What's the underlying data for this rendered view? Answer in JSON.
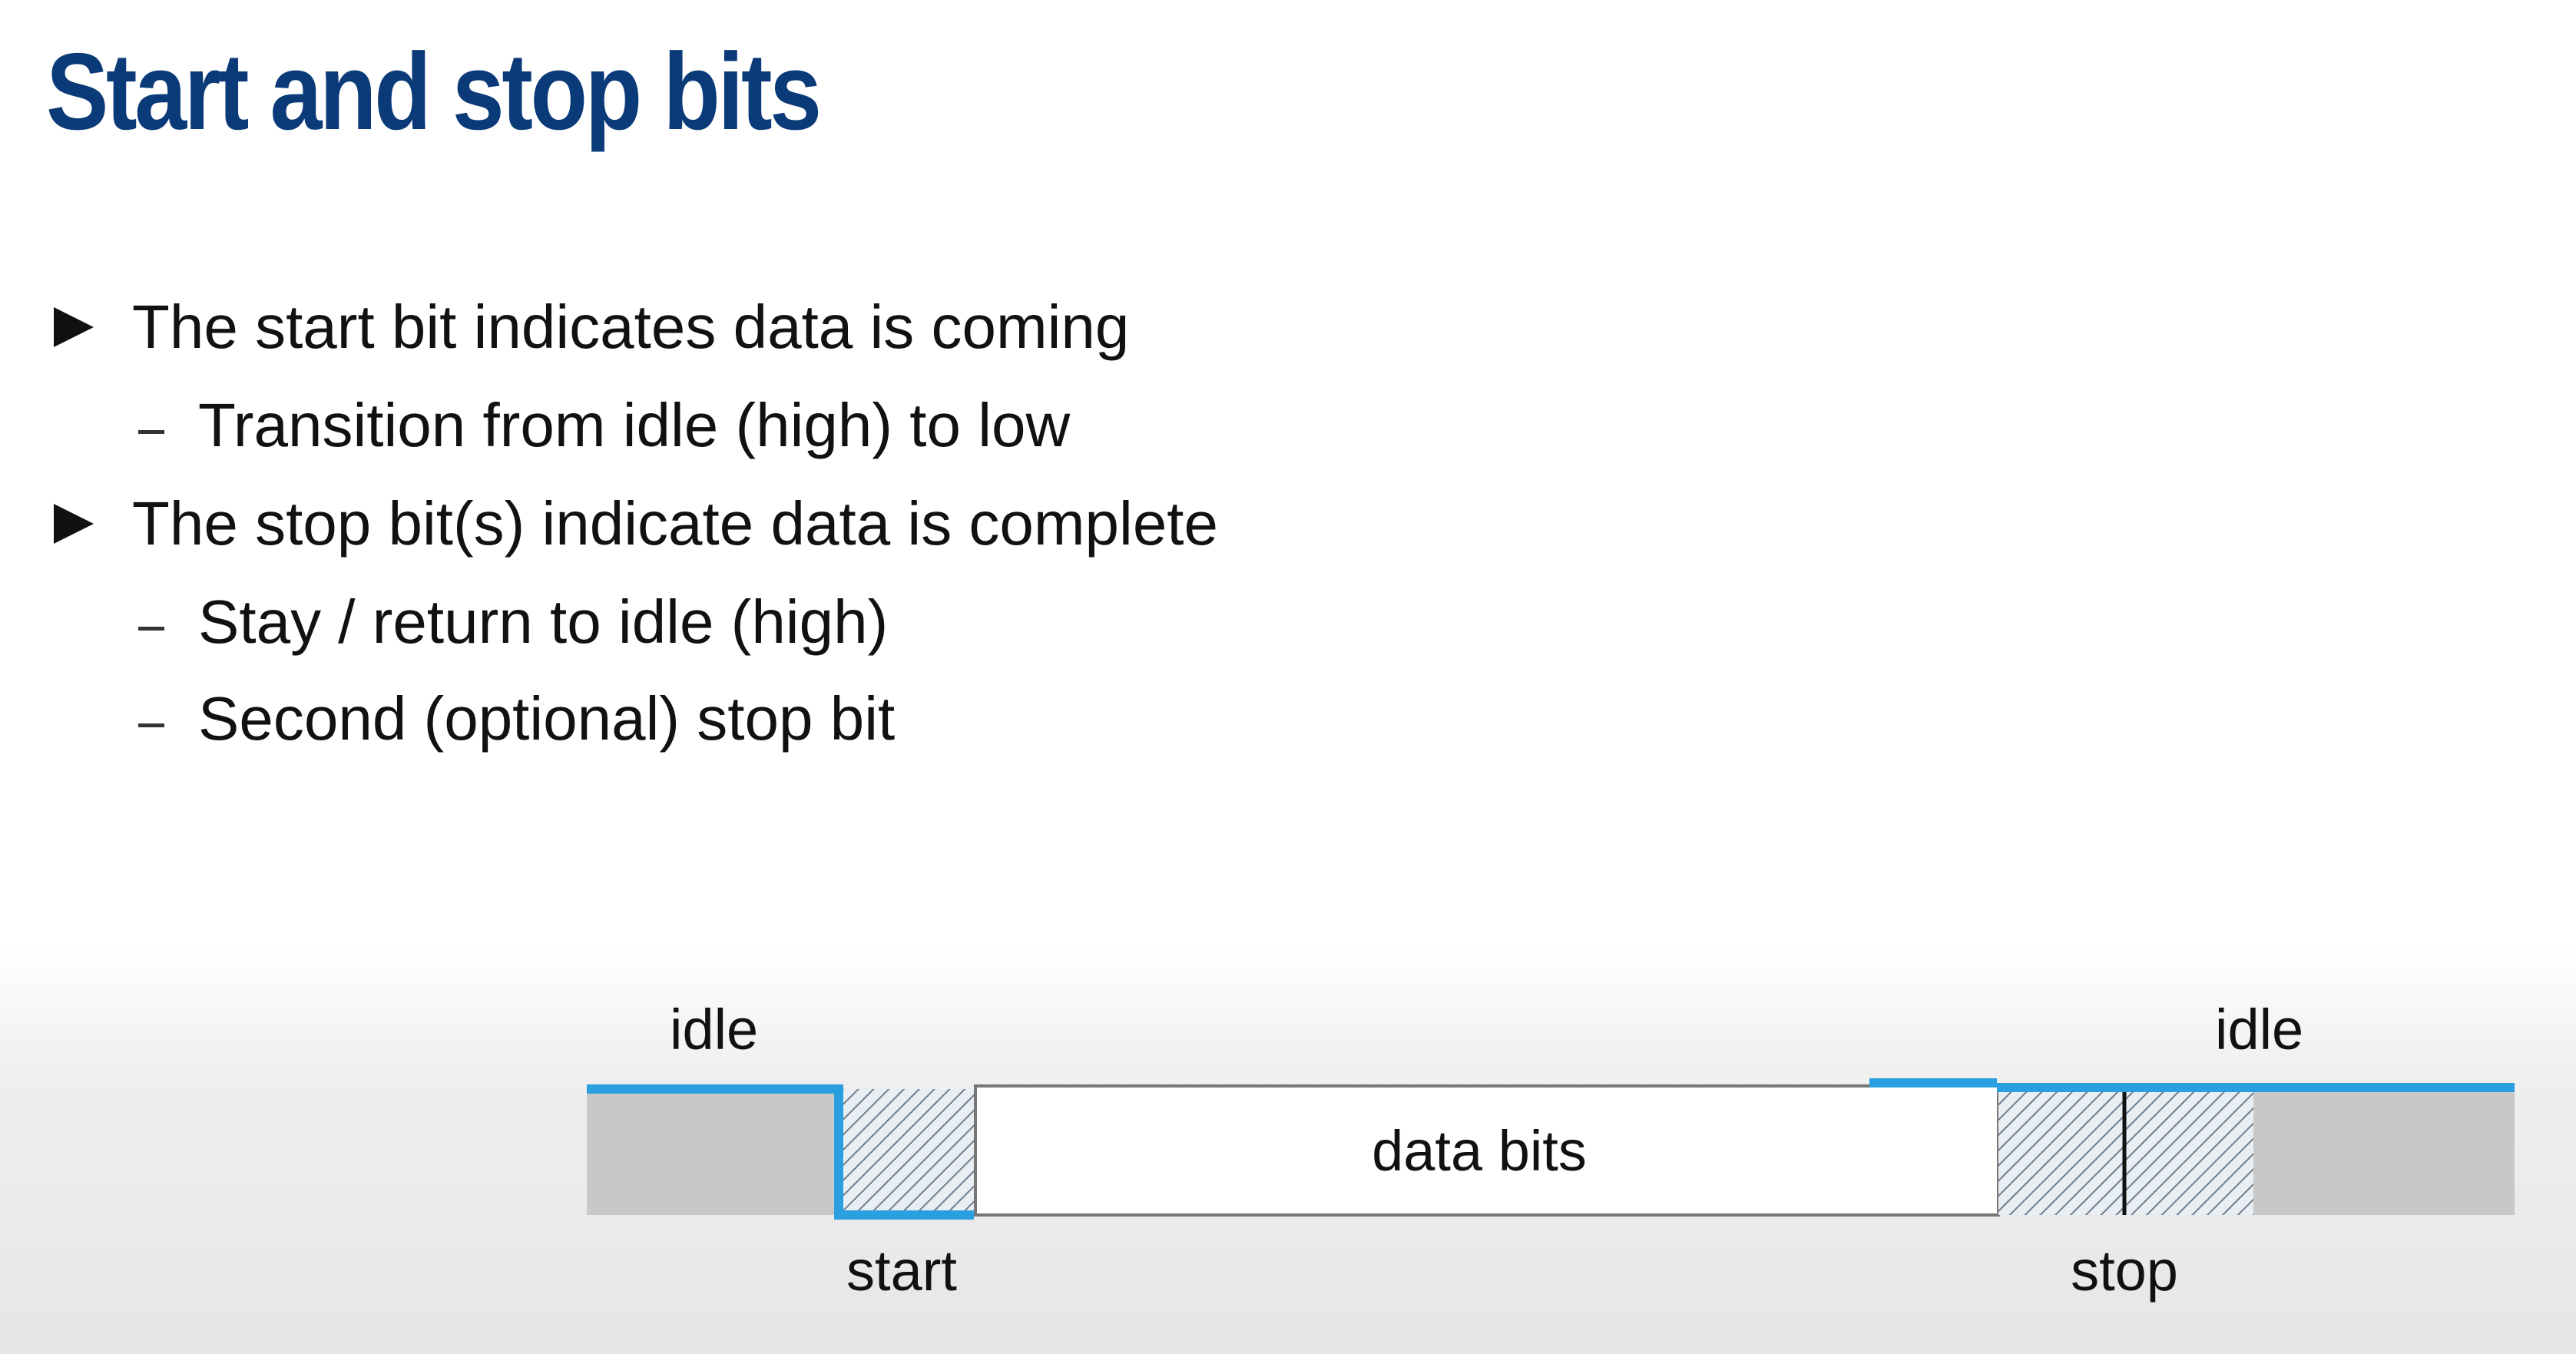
{
  "slide": {
    "title": "Start and stop bits"
  },
  "bullets": [
    {
      "level": 1,
      "marker": "triangle-bullet-icon",
      "text": "The start bit indicates data is coming"
    },
    {
      "level": 2,
      "marker": "dash-bullet-icon",
      "text": "Transition from idle (high) to low"
    },
    {
      "level": 1,
      "marker": "triangle-bullet-icon",
      "text": "The stop bit(s) indicate data is complete"
    },
    {
      "level": 2,
      "marker": "dash-bullet-icon",
      "text": "Stay / return to idle (high)"
    },
    {
      "level": 2,
      "marker": "dash-bullet-icon",
      "text": "Second (optional) stop bit"
    }
  ],
  "diagram": {
    "labels": {
      "idle_left": "idle",
      "idle_right": "idle",
      "start": "start",
      "data_bits": "data bits",
      "stop": "stop"
    },
    "colors": {
      "title": "#0a3a78",
      "signal_line": "#2a9fe0",
      "idle_fill": "#c8c8c8",
      "hatch": "#6c7f92",
      "text": "#111111"
    }
  }
}
